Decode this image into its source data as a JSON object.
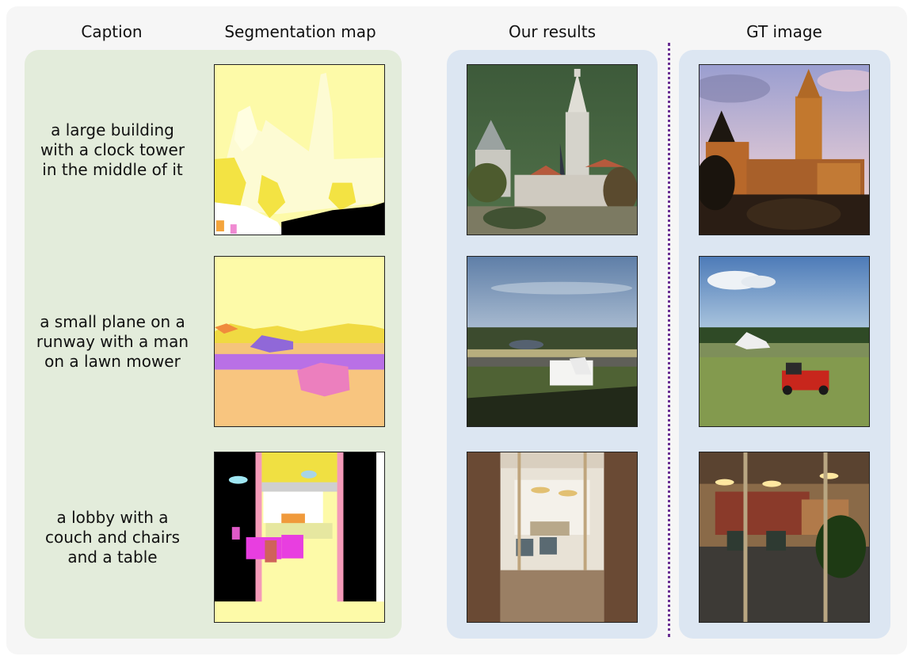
{
  "headers": {
    "caption": "Caption",
    "segmentation": "Segmentation map",
    "ours": "Our results",
    "gt": "GT image"
  },
  "rows": [
    {
      "caption_lines": [
        "a large building",
        "with a clock tower",
        "in the middle of it"
      ],
      "scene": "clock tower building"
    },
    {
      "caption_lines": [
        "a small plane on a",
        "runway with a man",
        "on a lawn mower"
      ],
      "scene": "airfield with plane and lawn mower"
    },
    {
      "caption_lines": [
        "a lobby with a",
        "couch and chairs",
        "and a table"
      ],
      "scene": "lobby interior behind glass doors"
    }
  ],
  "colors": {
    "caption_panel": "#e3ecdb",
    "results_panel": "#dce6f2",
    "divider": "#6a2f93"
  }
}
